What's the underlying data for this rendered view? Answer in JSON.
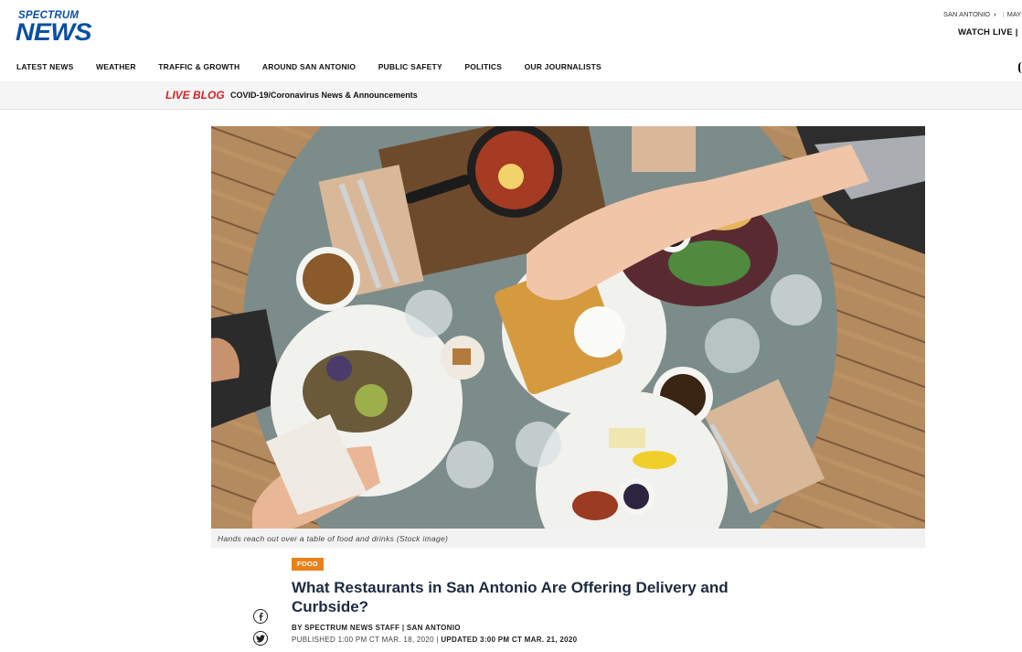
{
  "header": {
    "logo_line1": "SPECTRUM",
    "logo_line2": "NEWS",
    "location": "SAN ANTONIO",
    "location_next": "MAY",
    "watch_live": "WATCH LIVE"
  },
  "nav": {
    "items": [
      {
        "label": "LATEST NEWS"
      },
      {
        "label": "WEATHER"
      },
      {
        "label": "TRAFFIC & GROWTH"
      },
      {
        "label": "AROUND SAN ANTONIO"
      },
      {
        "label": "PUBLIC SAFETY"
      },
      {
        "label": "POLITICS"
      },
      {
        "label": "OUR JOURNALISTS"
      }
    ]
  },
  "live_blog": {
    "label": "LIVE BLOG",
    "text": "COVID-19/Coronavirus News & Announcements"
  },
  "hero": {
    "caption": "Hands reach out over a table of food and drinks (Stock image)"
  },
  "article": {
    "category": "FOOD",
    "headline": "What Restaurants in San Antonio Are Offering Delivery and Curbside?",
    "byline_author": "BY SPECTRUM NEWS STAFF",
    "byline_location": "SAN ANTONIO",
    "published": "PUBLISHED 1:00 PM CT MAR. 18, 2020",
    "updated": "UPDATED 3:00 PM CT MAR. 21, 2020"
  },
  "social": {
    "facebook_icon": "facebook-icon",
    "twitter_icon": "twitter-icon"
  },
  "colors": {
    "brand_blue": "#0b4fa0",
    "live_red": "#d2232a",
    "category_orange": "#e8811a",
    "headline_navy": "#1d2a40"
  }
}
